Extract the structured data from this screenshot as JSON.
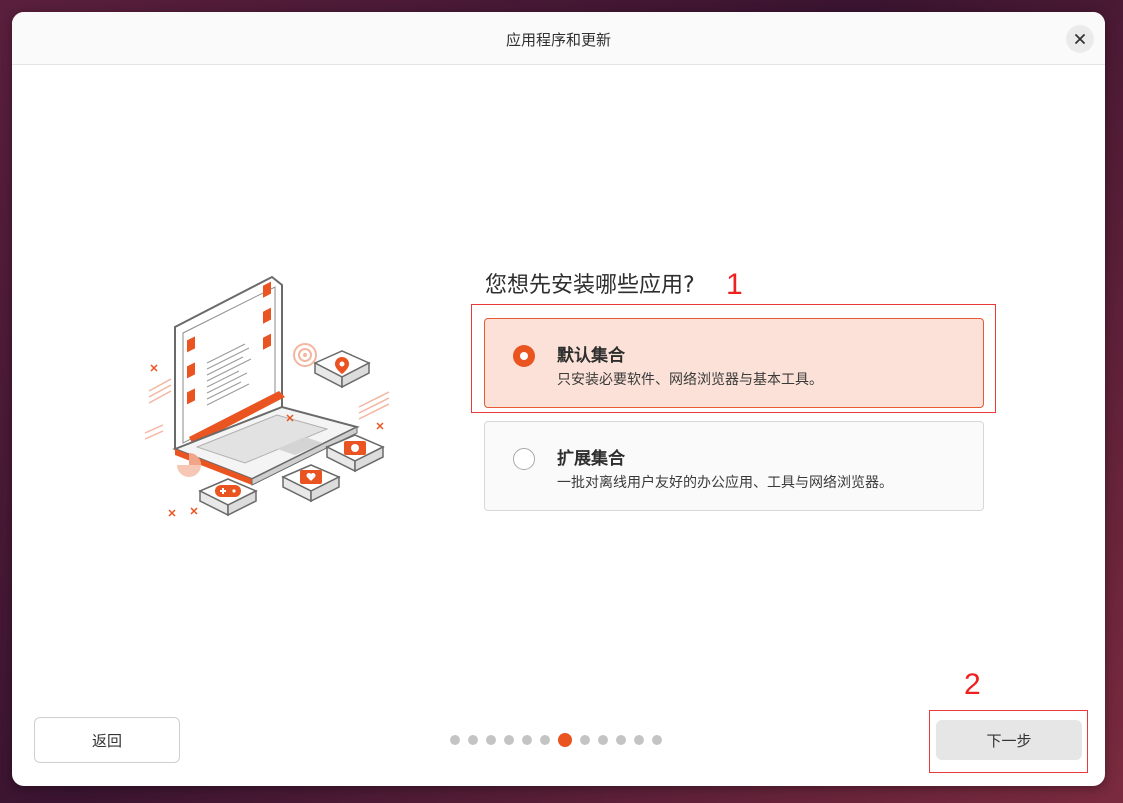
{
  "window": {
    "title": "应用程序和更新"
  },
  "main": {
    "heading": "您想先安装哪些应用?",
    "options": [
      {
        "title": "默认集合",
        "description": "只安装必要软件、网络浏览器与基本工具。",
        "selected": true
      },
      {
        "title": "扩展集合",
        "description": "一批对离线用户友好的办公应用、工具与网络浏览器。",
        "selected": false
      }
    ]
  },
  "footer": {
    "back_label": "返回",
    "next_label": "下一步",
    "pager": {
      "total": 12,
      "current": 7
    }
  },
  "annotations": {
    "label_1": "1",
    "label_2": "2"
  },
  "colors": {
    "accent": "#e95420",
    "selected_bg": "#fbe1d7",
    "annotation": "#ee2020"
  },
  "icons": {
    "close": "close-icon",
    "illustration": "laptop-apps-illustration"
  }
}
